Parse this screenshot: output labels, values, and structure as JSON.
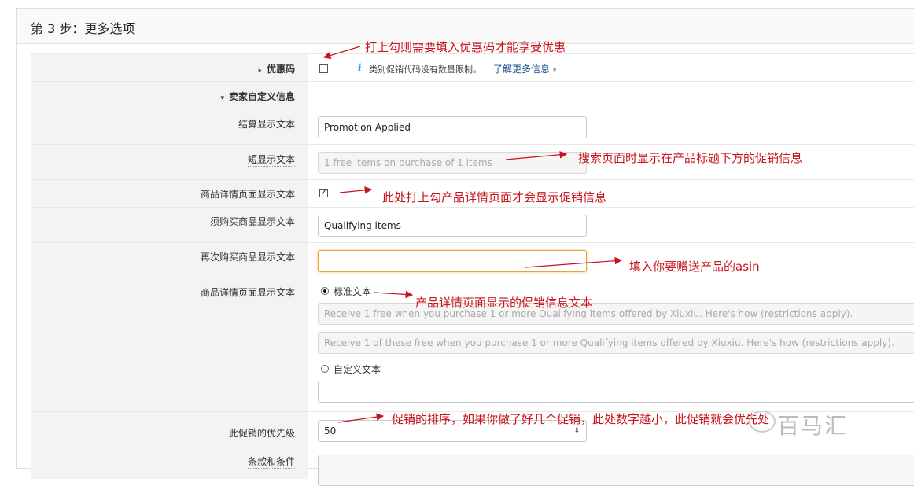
{
  "panel": {
    "title": "第 3 步：更多选项"
  },
  "rows": {
    "promo_code": {
      "label": "优惠码",
      "info": "类别促销代码没有数量限制。",
      "learn_more": "了解更多信息"
    },
    "seller_info": {
      "label": "卖家自定义信息"
    },
    "checkout_text": {
      "label": "结算显示文本",
      "value": "Promotion Applied"
    },
    "short_text": {
      "label": "短显示文本",
      "placeholder": "1 free items on purchase of 1 items"
    },
    "detail_page": {
      "label": "商品详情页面显示文本",
      "checked": true
    },
    "purchased_items": {
      "label": "须购买商品显示文本",
      "value": "Qualifying items"
    },
    "repurchase_items": {
      "label": "再次购买商品显示文本",
      "value": ""
    },
    "detail_text": {
      "label": "商品详情页面显示文本",
      "standard_label": "标准文本",
      "standard_1": "Receive 1 free when you purchase 1 or more Qualifying items offered by Xiuxiu. Here's how (restrictions apply).",
      "standard_2": "Receive 1 of these free when you purchase 1 or more Qualifying items offered by Xiuxiu. Here's how (restrictions apply).",
      "custom_label": "自定义文本"
    },
    "priority": {
      "label": "此促销的优先级",
      "value": "50"
    },
    "terms": {
      "label": "条款和条件"
    }
  },
  "annotations": {
    "a1": "打上勾则需要填入优惠码才能享受优惠",
    "a2": "搜索页面时显示在产品标题下方的促销信息",
    "a3": "此处打上勾产品详情页面才会显示促销信息",
    "a4": "填入你要赠送产品的asin",
    "a5": "产品详情页面显示的促销信息文本",
    "a6": "促销的排序，如果你做了好几个促销，此处数字越小，此促销就会优先处"
  },
  "watermark": "百马汇",
  "colors": {
    "annotation": "#c8141c",
    "link": "#1a4d8c",
    "focus_border": "#e8a33a"
  }
}
